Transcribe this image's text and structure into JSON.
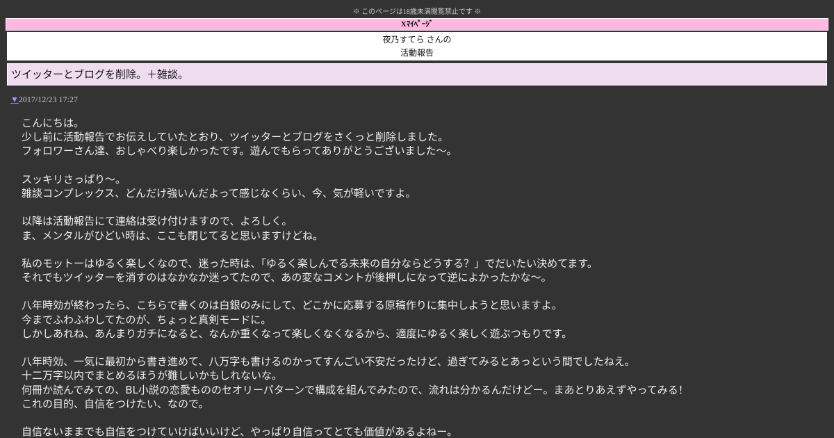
{
  "notice": "※ このページは18歳未満閲覧禁止です ※",
  "xmypage": "Xﾏｲﾍﾟｰｼﾞ",
  "title": {
    "line1": "夜乃すてら さんの",
    "line2": "活動報告"
  },
  "heading": "ツイッターとブログを削除。＋雑談。",
  "date": {
    "marker": "▼",
    "value": "2017/12/23 17:27"
  },
  "paragraphs": [
    [
      "こんにちは。",
      "少し前に活動報告でお伝えしていたとおり、ツイッターとブログをさくっと削除しました。",
      "フォロワーさん達、おしゃべり楽しかったです。遊んでもらってありがとうございました～。"
    ],
    [
      "スッキリさっぱり～。",
      "雑談コンプレックス、どんだけ強いんだよって感じなくらい、今、気が軽いですよ。"
    ],
    [
      "以降は活動報告にて連絡は受け付けますので、よろしく。",
      "ま、メンタルがひどい時は、ここも閉じてると思いますけどね。"
    ],
    [
      "私のモットーはゆるく楽しくなので、迷った時は、「ゆるく楽しんでる未来の自分ならどうする？」でだいたい決めてます。",
      "それでもツイッターを消すのはなかなか迷ってたので、あの変なコメントが後押しになって逆によかったかな～。"
    ],
    [
      "八年時効が終わったら、こちらで書くのは白銀のみにして、どこかに応募する原稿作りに集中しようと思いますよ。",
      "今までふわふわしてたのが、ちょっと真剣モードに。",
      "しかしあれね、あんまりガチになると、なんか重くなって楽しくなくなるから、適度にゆるく楽しく遊ぶつもりです。"
    ],
    [
      "八年時効、一気に最初から書き進めて、八万字も書けるのかってすんごい不安だったけど、過ぎてみるとあっという間でしたねえ。",
      "十二万字以内でまとめるほうが難しいかもしれないな。",
      "何冊か読んでみての、BL小説の恋愛もののセオリーパターンで構成を組んでみたので、流れは分かるんだけどー。まあとりあえずやってみる！",
      "これの目的、自信をつけたい、なので。"
    ],
    [
      "自信ないままでも自信をつけていけばいいけど、やっぱり自信ってとても価値があるよねー。"
    ]
  ]
}
